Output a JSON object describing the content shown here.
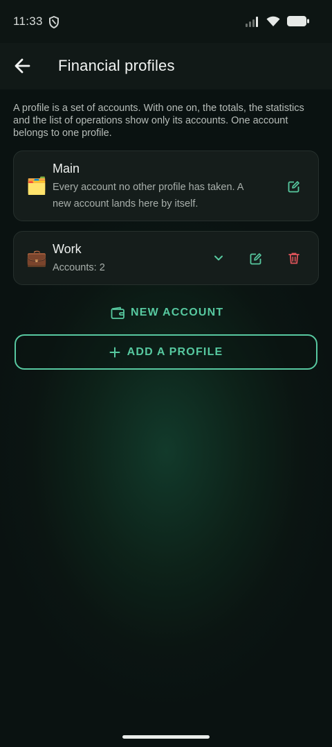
{
  "status_bar": {
    "time": "11:33"
  },
  "header": {
    "title": "Financial profiles"
  },
  "description": "A profile is a set of accounts. With one on, the totals, the statistics and the list of operations show only its accounts. One account belongs to one profile.",
  "profiles": [
    {
      "emoji": "🗂️",
      "name": "Main",
      "subtitle": "Every account no other profile has taken. A new account lands here by itself."
    },
    {
      "emoji": "💼",
      "name": "Work",
      "subtitle": "Accounts: 2"
    }
  ],
  "actions": {
    "new_account": "NEW ACCOUNT",
    "add_profile": "ADD A PROFILE"
  },
  "colors": {
    "accent": "#57c9a0",
    "danger": "#e0545b",
    "card_bg": "#151d1b"
  }
}
